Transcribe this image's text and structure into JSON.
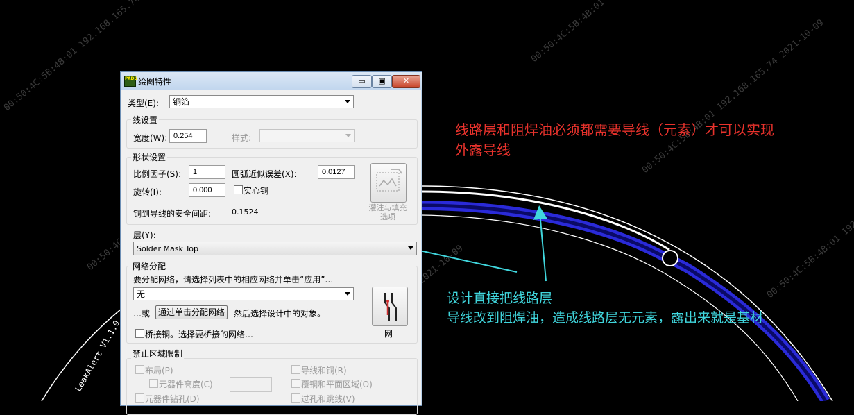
{
  "watermark": {
    "text": "00:50:4C:5B:4B:01 192.168.165.74 2021-10-09",
    "text_right": "00:50:4C:5B:4B:01 192.168.165.74 2021"
  },
  "pcb": {
    "board_outline_label": "LeakAlert V1.1.0"
  },
  "dialog": {
    "app_icon": "PADS",
    "title": "绘图特性",
    "window_buttons": {
      "minimize": "▭",
      "maximize": "▣",
      "close": "✕"
    },
    "type_label": "类型(E):",
    "type_value": "铜箔",
    "line_settings": {
      "title": "线设置",
      "width_label": "宽度(W):",
      "width_value": "0.254",
      "style_label": "样式:",
      "style_value": ""
    },
    "shape_settings": {
      "title": "形状设置",
      "scale_label": "比例因子(S):",
      "scale_value": "1",
      "arc_label": "圆弧近似误差(X):",
      "arc_value": "0.0127",
      "rotation_label": "旋转(I):",
      "rotation_value": "0.000",
      "solid_copper_label": "实心铜",
      "solid_copper_checked": false,
      "clearance_label": "铜到导线的安全间距:",
      "clearance_value": "0.1524",
      "pour_options_label": "灌注与填充\n选项",
      "pour_options_line1": "灌注与填充",
      "pour_options_line2": "选项"
    },
    "layer": {
      "label": "层(Y):",
      "value": "Solder Mask Top"
    },
    "net_assign": {
      "title": "网络分配",
      "instruction": "要分配网络，请选择列表中的相应网络并单击“应用”…",
      "net_value": "无",
      "or_label": "…或",
      "click_assign_button": "通过单击分配网络",
      "then_select": "然后选择设计中的对象。",
      "net_button_label": "网",
      "bridge_label": "桥接铜。选择要桥接的网络…",
      "bridge_checked": false
    },
    "keepout": {
      "title": "禁止区域限制",
      "placement": "布局(P)",
      "component_height": "元器件高度(C)",
      "component_height_value": "",
      "component_drill": "元器件钻孔(D)",
      "traces_copper": "导线和铜(R)",
      "copper_plane": "覆铜和平面区域(O)",
      "vias_jumpers": "过孔和跳线(V)"
    }
  },
  "annotations": {
    "red_line1": "线路层和阻焊油必须都需要导线（元素）才可以实现",
    "red_line2": "外露导线",
    "cyan_line1": "设计直接把线路层",
    "cyan_line2": "导线改到阻焊油，造成线路层无元素，露出来就是基材"
  },
  "colors": {
    "background": "#000000",
    "trace_blue": "#1b1bb4",
    "trace_white": "#ffffff",
    "annotation_red": "#e8322c",
    "annotation_cyan": "#40d6dd"
  }
}
